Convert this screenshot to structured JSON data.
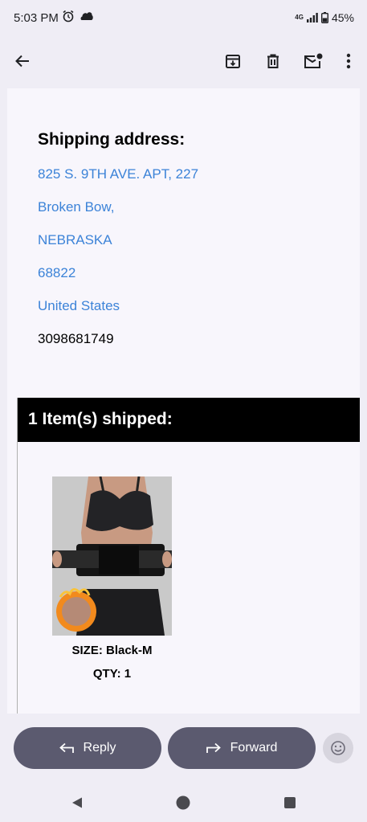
{
  "status_bar": {
    "time": "5:03 PM",
    "network": "4G",
    "battery": "45%"
  },
  "app_bar": {
    "icons": [
      "back-arrow-icon",
      "archive-icon",
      "delete-icon",
      "mark-unread-icon",
      "more-icon"
    ]
  },
  "email": {
    "shipping_heading": "Shipping address:",
    "address": {
      "street": "825 S. 9TH AVE. APT, 227",
      "city": "Broken Bow,",
      "state": "NEBRASKA",
      "zip": "68822",
      "country": "United States"
    },
    "phone": "3098681749",
    "items_header": "1 Item(s) shipped:",
    "product": {
      "size": "SIZE: Black-M",
      "qty": "QTY: 1"
    }
  },
  "actions": {
    "reply_label": "Reply",
    "forward_label": "Forward"
  },
  "colors": {
    "link": "#3c83d8",
    "button": "#5b5a6f",
    "header_bg": "#000000"
  }
}
